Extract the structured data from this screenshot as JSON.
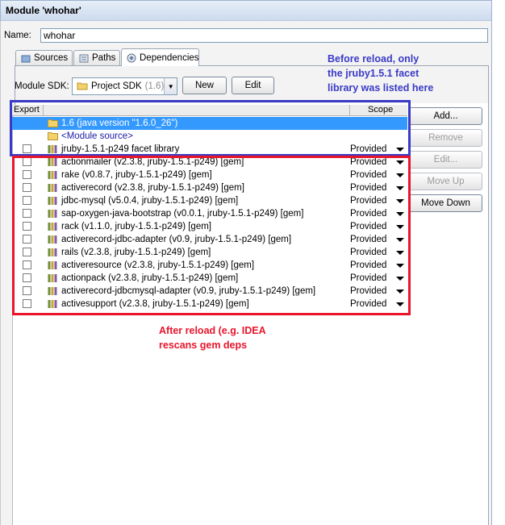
{
  "window": {
    "title": "Module 'whohar'"
  },
  "name_field": {
    "label": "Name:",
    "value": "whohar"
  },
  "tabs": [
    {
      "label": "Sources",
      "icon": "sources-folder-icon"
    },
    {
      "label": "Paths",
      "icon": "paths-icon"
    },
    {
      "label": "Dependencies",
      "icon": "dependencies-icon"
    }
  ],
  "sdk": {
    "label": "Module SDK:",
    "value": "Project SDK",
    "version": "(1.6)"
  },
  "buttons": {
    "new": "New",
    "edit": "Edit",
    "add": "Add...",
    "remove": "Remove",
    "edit_dots": "Edit...",
    "move_up": "Move Up",
    "move_down": "Move Down"
  },
  "table": {
    "columns": {
      "export": "Export",
      "scope": "Scope"
    },
    "jdk_row": "1.6 (java version \"1.6.0_26\")",
    "source_row": "<Module source>",
    "rows": [
      {
        "name": "jruby-1.5.1-p249 facet library",
        "scope": "Provided"
      },
      {
        "name": "actionmailer (v2.3.8, jruby-1.5.1-p249) [gem]",
        "scope": "Provided"
      },
      {
        "name": "rake (v0.8.7, jruby-1.5.1-p249) [gem]",
        "scope": "Provided"
      },
      {
        "name": "activerecord (v2.3.8, jruby-1.5.1-p249) [gem]",
        "scope": "Provided"
      },
      {
        "name": "jdbc-mysql (v5.0.4, jruby-1.5.1-p249) [gem]",
        "scope": "Provided"
      },
      {
        "name": "sap-oxygen-java-bootstrap (v0.0.1, jruby-1.5.1-p249) [gem]",
        "scope": "Provided"
      },
      {
        "name": "rack (v1.1.0, jruby-1.5.1-p249) [gem]",
        "scope": "Provided"
      },
      {
        "name": "activerecord-jdbc-adapter (v0.9, jruby-1.5.1-p249) [gem]",
        "scope": "Provided"
      },
      {
        "name": "rails (v2.3.8, jruby-1.5.1-p249) [gem]",
        "scope": "Provided"
      },
      {
        "name": "activeresource (v2.3.8, jruby-1.5.1-p249) [gem]",
        "scope": "Provided"
      },
      {
        "name": "actionpack (v2.3.8, jruby-1.5.1-p249) [gem]",
        "scope": "Provided"
      },
      {
        "name": "activerecord-jdbcmysql-adapter (v0.9, jruby-1.5.1-p249) [gem]",
        "scope": "Provided"
      },
      {
        "name": "activesupport (v2.3.8, jruby-1.5.1-p249) [gem]",
        "scope": "Provided"
      }
    ]
  },
  "annotations": {
    "before": [
      "Before reload, only",
      "the jruby1.5.1 facet",
      "library was listed here"
    ],
    "after": [
      "After reload (e.g. IDEA",
      "rescans gem deps"
    ]
  },
  "colors": {
    "selection": "#3399ff",
    "annotation_blue": "#3a3ac8",
    "annotation_red": "#e8152b"
  }
}
